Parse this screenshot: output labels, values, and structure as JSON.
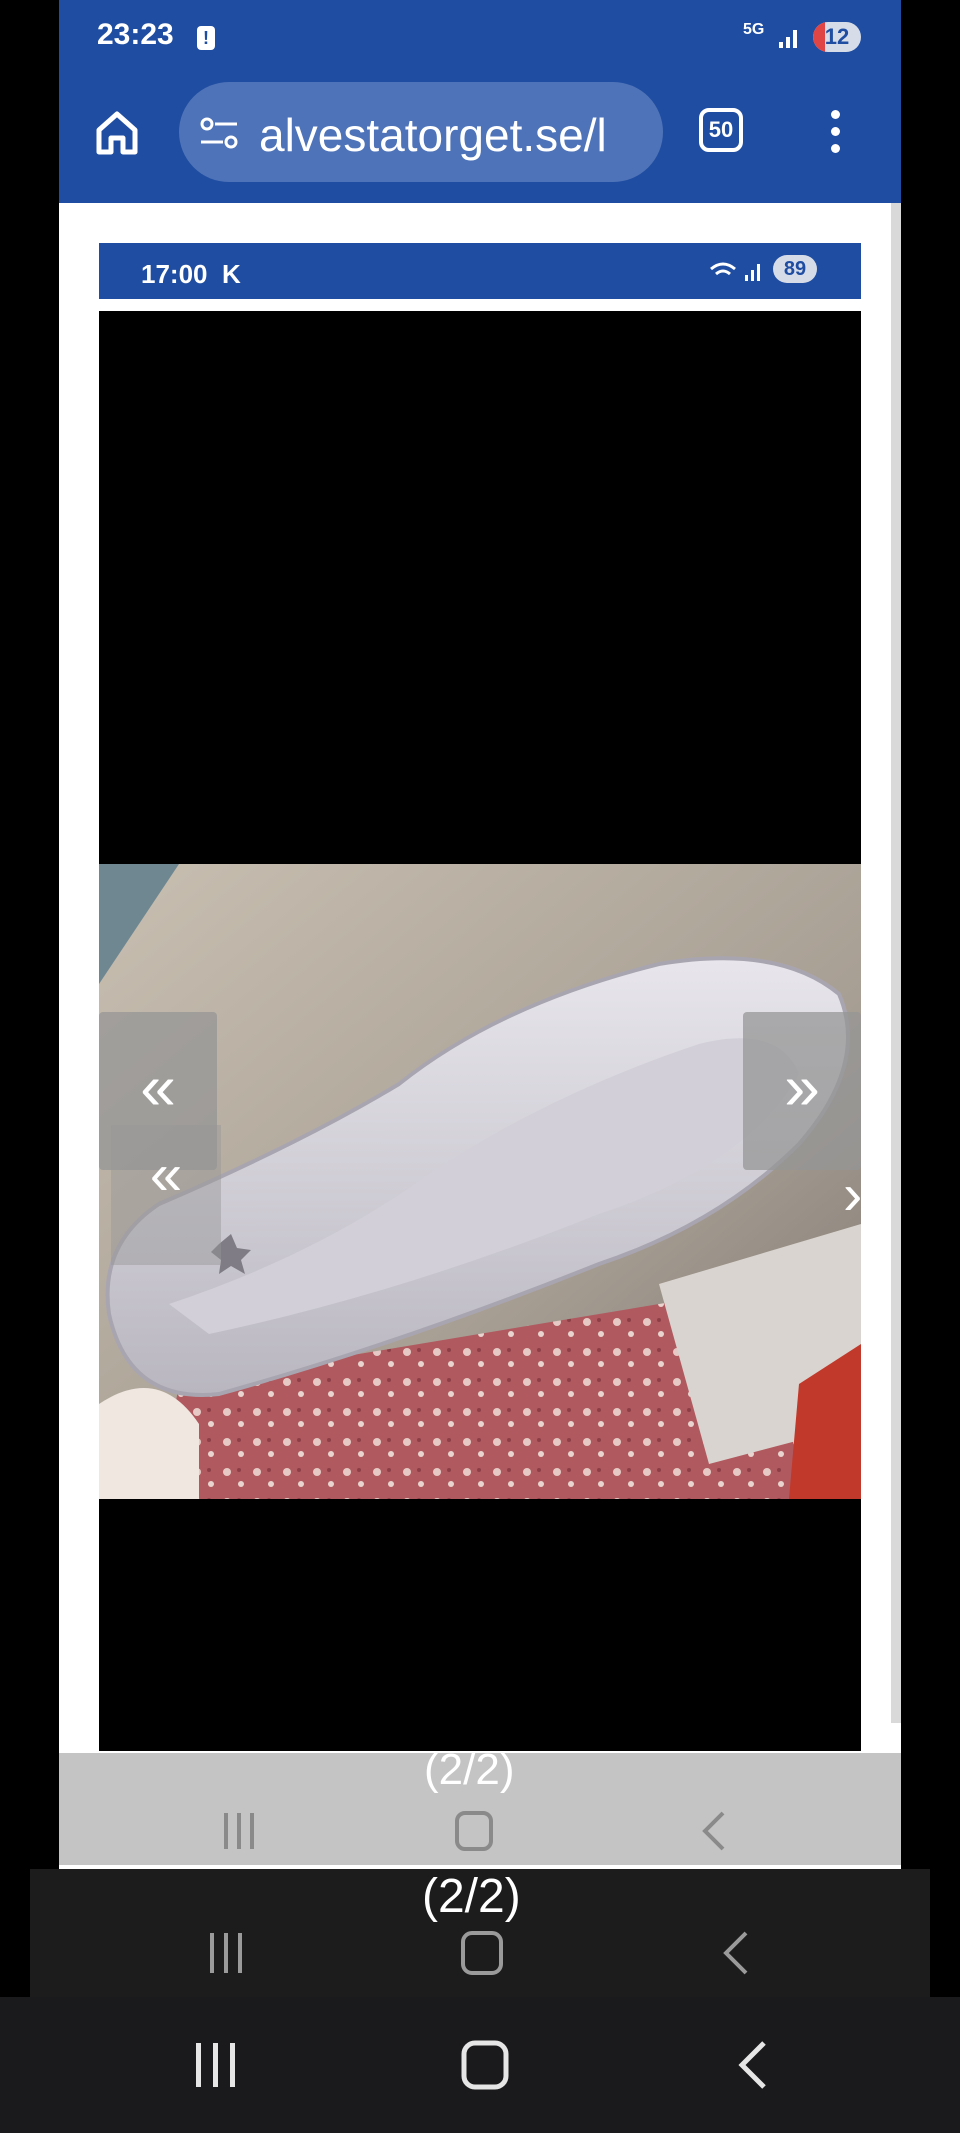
{
  "status_bar": {
    "time": "23:23",
    "alert_icon": "!",
    "network": "5G",
    "battery": "12"
  },
  "browser": {
    "url": "alvestatorget.se/l",
    "tab_count": "50",
    "icons": [
      "home-icon",
      "site-settings-icon",
      "tab-switcher-icon",
      "overflow-menu-icon"
    ]
  },
  "embedded_screenshot": {
    "time": "17:00",
    "notification": "K",
    "battery": "89"
  },
  "gallery": {
    "prev_label": "«",
    "next_label": "»",
    "counter": "(2/2)"
  },
  "colors": {
    "brand_blue": "#1f4da1",
    "url_pill": "#4e73b8"
  }
}
